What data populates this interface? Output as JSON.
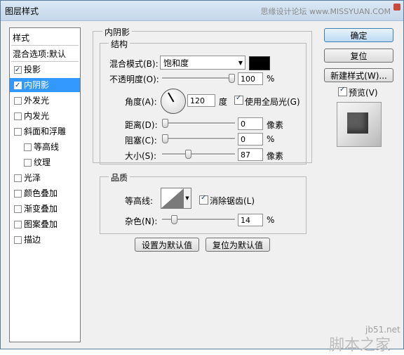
{
  "window": {
    "title": "图层样式",
    "watermark": "思缘设计论坛 www.MISSYUAN.COM"
  },
  "sidebar": {
    "header": "样式",
    "blend_default": "混合选项:默认",
    "items": [
      {
        "label": "投影",
        "checked": true
      },
      {
        "label": "内阴影",
        "checked": true,
        "selected": true
      },
      {
        "label": "外发光",
        "checked": false
      },
      {
        "label": "内发光",
        "checked": false
      },
      {
        "label": "斜面和浮雕",
        "checked": false
      },
      {
        "label": "等高线",
        "checked": false,
        "sub": true
      },
      {
        "label": "纹理",
        "checked": false,
        "sub": true
      },
      {
        "label": "光泽",
        "checked": false
      },
      {
        "label": "颜色叠加",
        "checked": false
      },
      {
        "label": "渐变叠加",
        "checked": false
      },
      {
        "label": "图案叠加",
        "checked": false
      },
      {
        "label": "描边",
        "checked": false
      }
    ]
  },
  "panel": {
    "title": "内阴影",
    "structure": {
      "title": "结构",
      "blend_mode_label": "混合模式(B):",
      "blend_mode_value": "饱和度",
      "blend_color": "#000000",
      "opacity_label": "不透明度(O):",
      "opacity_value": "100",
      "opacity_unit": "%",
      "angle_label": "角度(A):",
      "angle_value": "120",
      "angle_unit": "度",
      "global_light_label": "使用全局光(G)",
      "global_light_checked": true,
      "distance_label": "距离(D):",
      "distance_value": "0",
      "distance_unit": "像素",
      "choke_label": "阻塞(C):",
      "choke_value": "0",
      "choke_unit": "%",
      "size_label": "大小(S):",
      "size_value": "87",
      "size_unit": "像素"
    },
    "quality": {
      "title": "品质",
      "contour_label": "等高线:",
      "antialias_label": "消除锯齿(L)",
      "antialias_checked": true,
      "noise_label": "杂色(N):",
      "noise_value": "14",
      "noise_unit": "%"
    },
    "make_default": "设置为默认值",
    "reset_default": "复位为默认值"
  },
  "actions": {
    "ok": "确定",
    "reset": "复位",
    "new_style": "新建样式(W)...",
    "preview_label": "预览(V)",
    "preview_checked": true
  },
  "logo": {
    "site": "jb51.net",
    "text": "脚本之家"
  }
}
